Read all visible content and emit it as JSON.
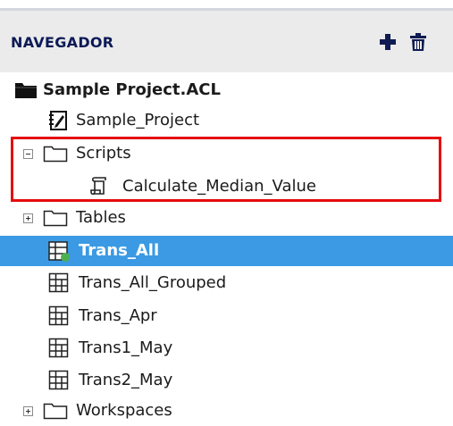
{
  "navigator": {
    "title": "NAVEGADOR"
  },
  "tree": {
    "items": [
      {
        "label": "Sample Project.ACL",
        "icon": "folder-filled-icon"
      },
      {
        "label": "Sample_Project",
        "icon": "notebook-icon"
      },
      {
        "label": "Scripts",
        "icon": "folder-icon",
        "expander": "collapse"
      },
      {
        "label": "Calculate_Median_Value",
        "icon": "script-icon"
      },
      {
        "label": "Tables",
        "icon": "folder-icon",
        "expander": "expand"
      },
      {
        "label": "Trans_All",
        "icon": "table-active-icon",
        "selected": true
      },
      {
        "label": "Trans_All_Grouped",
        "icon": "table-icon"
      },
      {
        "label": "Trans_Apr",
        "icon": "table-icon"
      },
      {
        "label": "Trans1_May",
        "icon": "table-icon"
      },
      {
        "label": "Trans2_May",
        "icon": "table-icon"
      },
      {
        "label": "Workspaces",
        "icon": "folder-icon",
        "expander": "expand"
      }
    ]
  },
  "colors": {
    "selection": "#3b9ae3",
    "highlight_box": "#e50c0c",
    "header_text": "#0d1a57"
  }
}
